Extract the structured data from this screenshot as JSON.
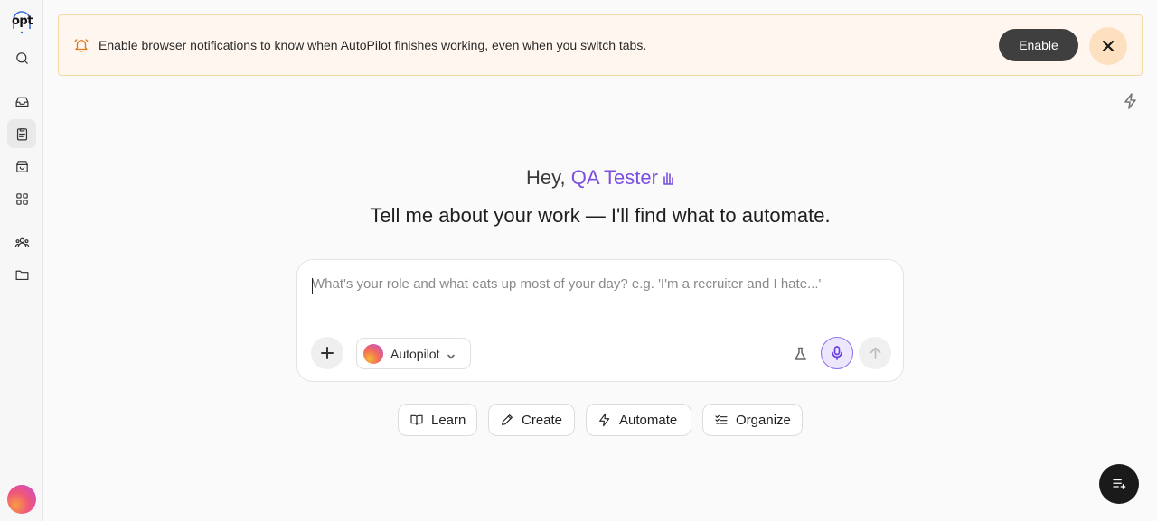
{
  "brand": {
    "logo_text": "opt"
  },
  "sidebar": {
    "items": [
      {
        "icon": "search-icon"
      },
      {
        "icon": "inbox-icon"
      },
      {
        "icon": "clipboard-icon"
      },
      {
        "icon": "store-icon"
      },
      {
        "icon": "apps-grid-icon"
      },
      {
        "icon": "users-icon"
      },
      {
        "icon": "folder-icon"
      }
    ]
  },
  "banner": {
    "message": "Enable browser notifications to know when AutoPilot finishes working, even when you switch tabs.",
    "enable_label": "Enable",
    "accent": "#e0791a"
  },
  "greeting": {
    "prefix": "Hey,",
    "name": "QA Tester",
    "tagline": "Tell me about your work — I'll find what to automate."
  },
  "composer": {
    "placeholder": "What's your role and what eats up most of your day? e.g. 'I'm a recruiter and I hate...'",
    "value": "",
    "model_label": "Autopilot"
  },
  "chips": [
    {
      "label": "Learn",
      "icon": "book-icon"
    },
    {
      "label": "Create",
      "icon": "pencil-icon"
    },
    {
      "label": "Automate",
      "icon": "bolt-icon"
    },
    {
      "label": "Organize",
      "icon": "list-check-icon"
    }
  ],
  "colors": {
    "accent_purple": "#7b4fe0",
    "dark_button": "#3f3f3f"
  }
}
